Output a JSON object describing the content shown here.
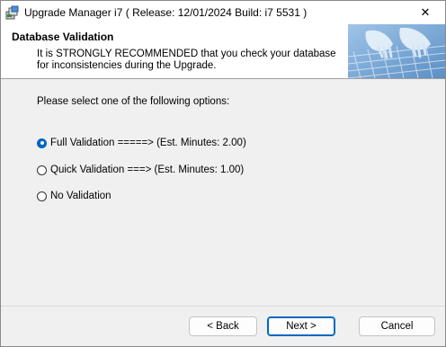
{
  "window": {
    "title": "Upgrade Manager i7 ( Release: 12/01/2024   Build: i7 5531 )",
    "close_glyph": "✕"
  },
  "header": {
    "title": "Database Validation",
    "description": "It is STRONGLY RECOMMENDED that you check your database for inconsistencies during the Upgrade.",
    "image_icon": "keyboard-typing-image"
  },
  "main": {
    "prompt": "Please select one of the following options:",
    "options": [
      {
        "label": "Full Validation =====> (Est. Minutes:   2.00)",
        "selected": true
      },
      {
        "label": "Quick Validation ===> (Est. Minutes:   1.00)",
        "selected": false
      },
      {
        "label": "No Validation",
        "selected": false
      }
    ]
  },
  "buttons": {
    "back": "< Back",
    "next": "Next >",
    "cancel": "Cancel"
  },
  "colors": {
    "accent": "#0067c0",
    "window_bg": "#f0f0f0",
    "header_bg": "#ffffff"
  }
}
